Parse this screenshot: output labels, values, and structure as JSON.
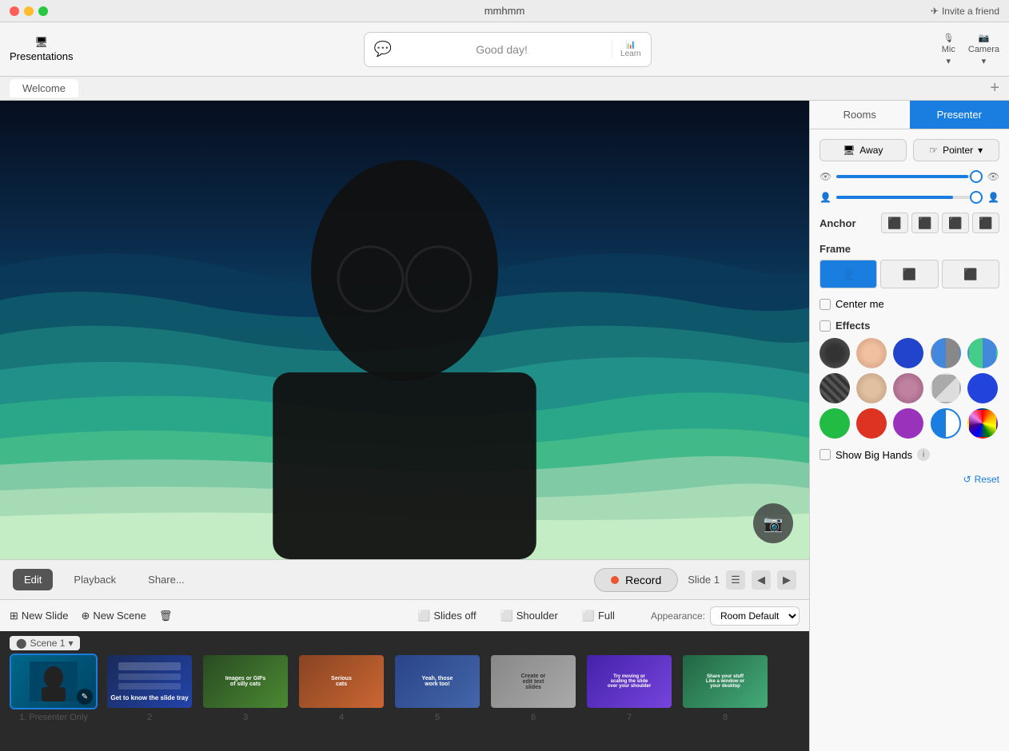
{
  "app": {
    "title": "mmhmm",
    "tab_welcome": "Welcome",
    "tab_plus": "+"
  },
  "titlebar": {
    "invite_label": "Invite a friend"
  },
  "toolbar": {
    "presentations_label": "Presentations",
    "good_day": "Good day!",
    "learn_label": "Learn",
    "mic_label": "Mic",
    "camera_label": "Camera"
  },
  "edit_bar": {
    "edit_label": "Edit",
    "playback_label": "Playback",
    "share_label": "Share...",
    "record_label": "Record",
    "slide_label": "Slide 1"
  },
  "scene_bar": {
    "new_slide_label": "New Slide",
    "new_scene_label": "New Scene",
    "slides_off_label": "Slides off",
    "shoulder_label": "Shoulder",
    "full_label": "Full",
    "appearance_label": "Appearance:",
    "room_default_label": "Room Default"
  },
  "panel": {
    "rooms_tab": "Rooms",
    "presenter_tab": "Presenter",
    "away_label": "Away",
    "pointer_label": "Pointer",
    "anchor_label": "Anchor",
    "frame_label": "Frame",
    "center_me_label": "Center me",
    "effects_label": "Effects",
    "show_big_hands_label": "Show Big Hands",
    "reset_label": "Reset"
  },
  "scene_strip": {
    "scene_label": "Scene 1",
    "slides": [
      {
        "number": "1",
        "label": "Presenter Only",
        "selected": true
      },
      {
        "number": "2",
        "label": "2",
        "selected": false
      },
      {
        "number": "3",
        "label": "3",
        "selected": false
      },
      {
        "number": "4",
        "label": "4",
        "selected": false
      },
      {
        "number": "5",
        "label": "5",
        "selected": false
      },
      {
        "number": "6",
        "label": "6",
        "selected": false
      },
      {
        "number": "7",
        "label": "7",
        "selected": false
      },
      {
        "number": "8",
        "label": "8",
        "selected": false
      }
    ]
  }
}
